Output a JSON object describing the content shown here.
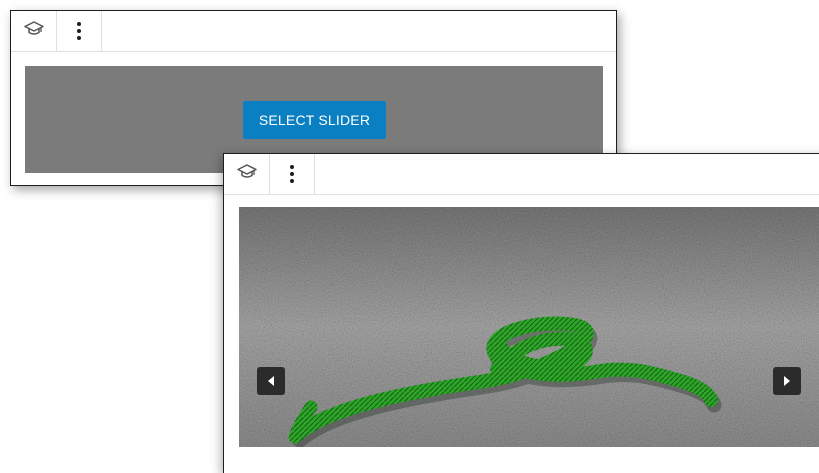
{
  "back_block": {
    "toolbar": {
      "block_icon": "graduation-cap-icon",
      "more_icon": "vertical-ellipsis-icon"
    },
    "placeholder": {
      "select_label": "SELECT SLIDER"
    }
  },
  "front_block": {
    "toolbar": {
      "block_icon": "graduation-cap-icon",
      "more_icon": "vertical-ellipsis-icon"
    },
    "slider": {
      "image": "green-rope-knot-on-gray-carpet",
      "prev_icon": "caret-left-icon",
      "next_icon": "caret-right-icon"
    }
  },
  "colors": {
    "accent": "#0a7fc2",
    "placeholder_bg": "#7b7b7b",
    "rope": "#2fa82a",
    "arrow_bg": "#2b2b2b",
    "border": "#1e1e1e"
  }
}
